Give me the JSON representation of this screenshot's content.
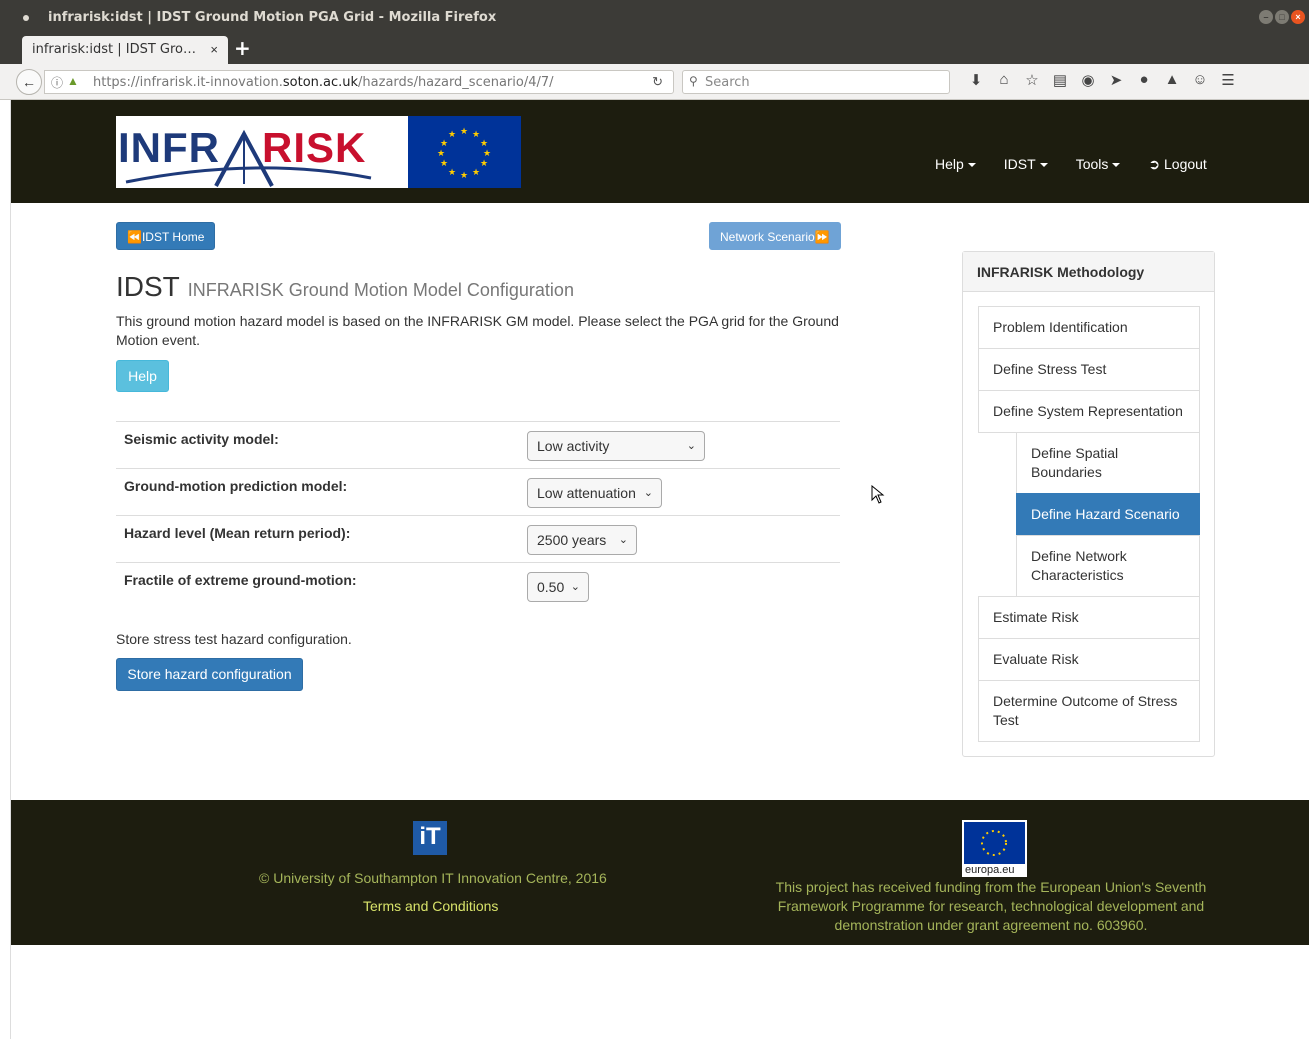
{
  "window": {
    "title": "infrarisk:idst | IDST Ground Motion PGA Grid - Mozilla Firefox",
    "tab_title": "infrarisk:idst | IDST Gro…",
    "tab_close": "×",
    "new_tab": "+"
  },
  "navbar": {
    "url_prefix": "https://infrarisk.it-innovation.",
    "url_domain": "soton.ac.uk",
    "url_path": "/hazards/hazard_scenario/4/7/",
    "search_placeholder": "Search"
  },
  "header": {
    "logo_text_a": "INFR",
    "logo_text_b": "RISK",
    "nav": [
      {
        "label": "Help"
      },
      {
        "label": "IDST"
      },
      {
        "label": "Tools"
      },
      {
        "label": "Logout"
      }
    ]
  },
  "main": {
    "home_button": "IDST Home",
    "next_button": "Network Scenario",
    "title": "IDST",
    "subtitle": "INFRARISK Ground Motion Model Configuration",
    "description": "This ground motion hazard model is based on the INFRARISK GM model. Please select the PGA grid for the Ground Motion event.",
    "help_button": "Help",
    "form": [
      {
        "label": "Seismic activity model:",
        "value": "Low activity"
      },
      {
        "label": "Ground-motion prediction model:",
        "value": "Low attenuation"
      },
      {
        "label": "Hazard level (Mean return period):",
        "value": "2500 years"
      },
      {
        "label": "Fractile of extreme ground-motion:",
        "value": "0.50"
      }
    ],
    "store_text": "Store stress test hazard configuration.",
    "store_button": "Store hazard configuration"
  },
  "sidebar": {
    "heading": "INFRARISK Methodology",
    "items": [
      {
        "label": "Problem Identification"
      },
      {
        "label": "Define Stress Test"
      },
      {
        "label": "Define System Representation"
      },
      {
        "label": "Define Spatial Boundaries"
      },
      {
        "label": "Define Hazard Scenario"
      },
      {
        "label": "Define Network Characteristics"
      },
      {
        "label": "Estimate Risk"
      },
      {
        "label": "Evaluate Risk"
      },
      {
        "label": "Determine Outcome of Stress Test"
      }
    ]
  },
  "footer": {
    "copyright": "© University of Southampton IT Innovation Centre, 2016",
    "terms": "Terms and Conditions",
    "eu_label": "europa.eu",
    "funding": "This project has received funding from the European Union's Seventh Framework Programme for research, technological development and demonstration under grant agreement no. 603960."
  },
  "colors": {
    "header_bg": "#1d1d0f",
    "primary": "#337ab7",
    "info": "#5bc0de",
    "footer_text": "#a5b55a"
  }
}
